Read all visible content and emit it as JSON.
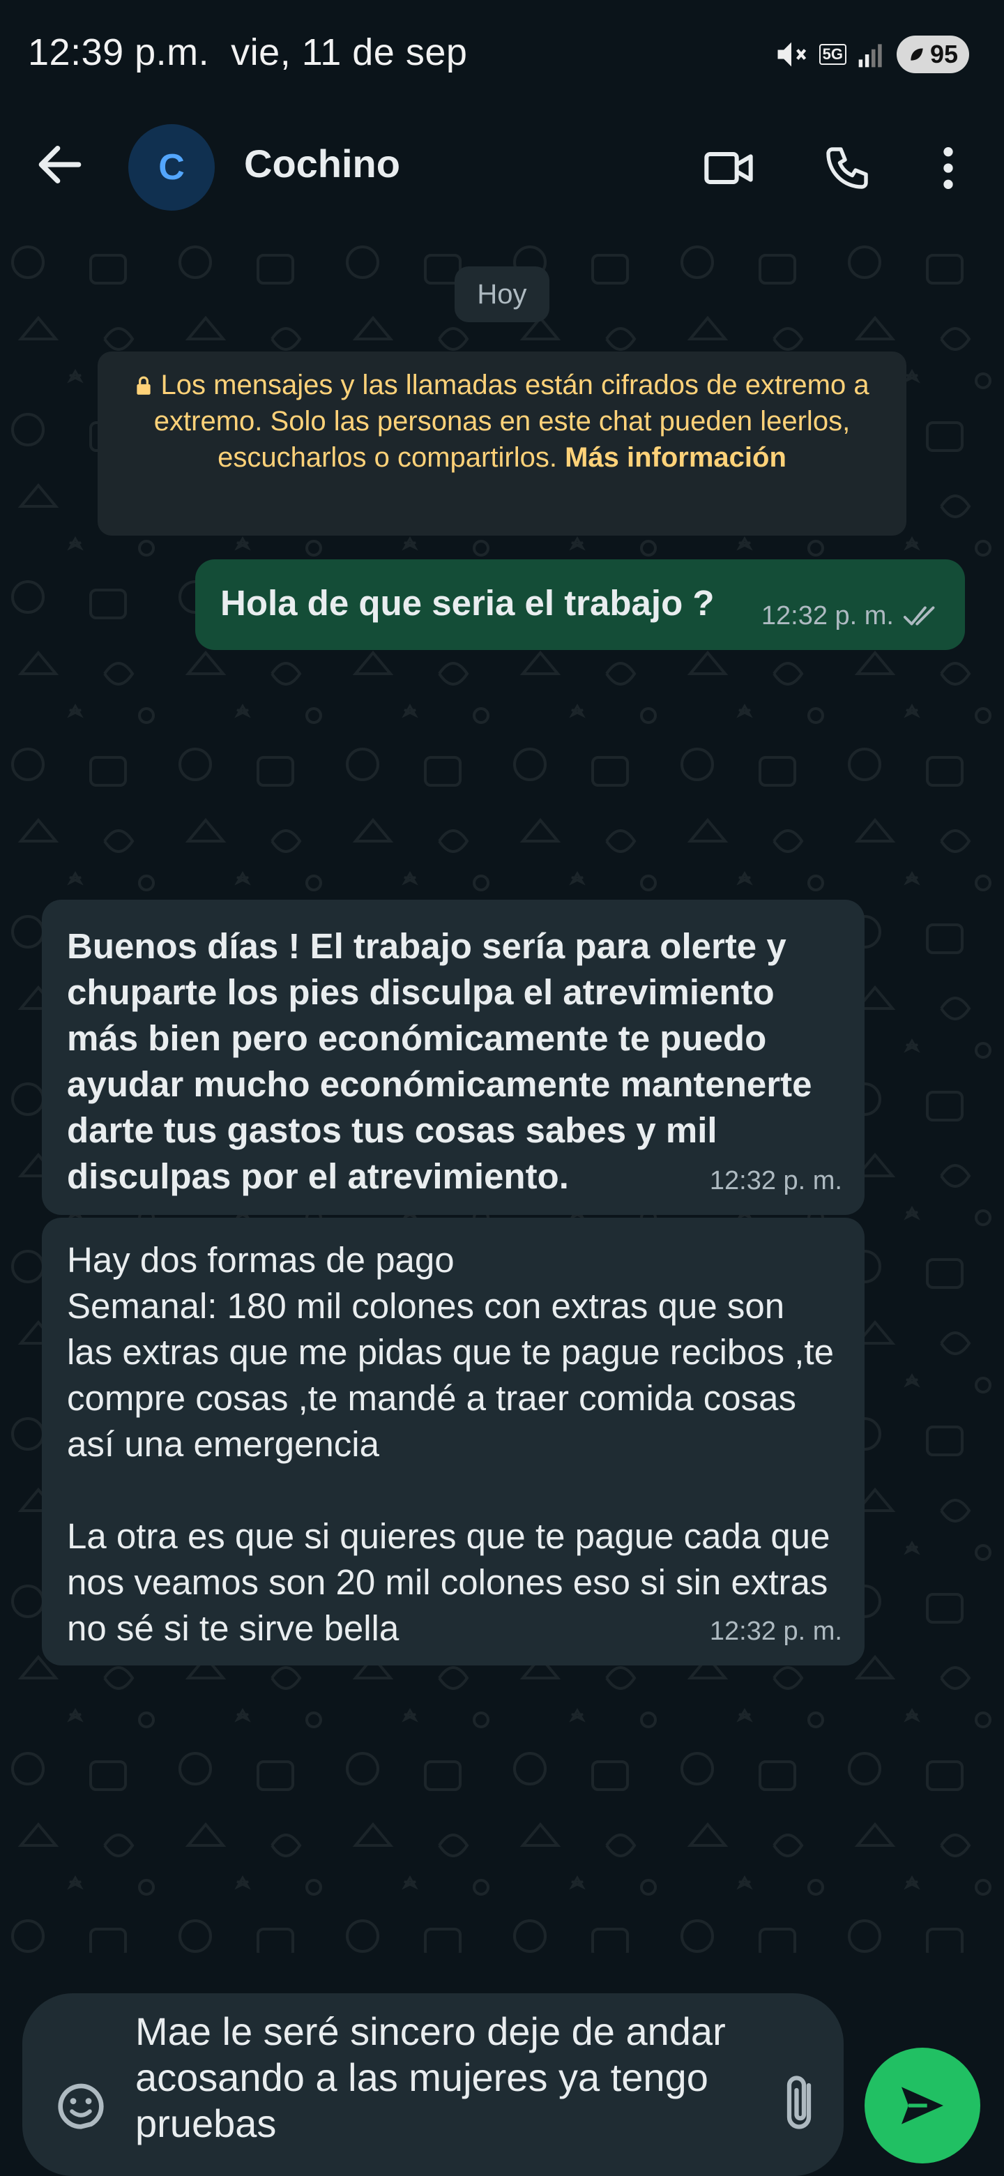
{
  "status_bar": {
    "time": "12:39 p.m.",
    "date": "vie, 11 de sep",
    "network": "5G",
    "battery": "95"
  },
  "header": {
    "avatar_initial": "C",
    "contact_name": "Cochino"
  },
  "chat": {
    "day_label": "Hoy",
    "encryption_notice": "Los mensajes y las llamadas están cifrados de extremo a extremo. Solo las personas en este chat pueden leerlos, escucharlos o compartirlos.",
    "encryption_link": "Más información",
    "messages": [
      {
        "direction": "out",
        "text": "Hola de que seria el trabajo ?",
        "time": "12:32 p. m."
      },
      {
        "direction": "in",
        "text": "Buenos días ! El trabajo sería para olerte y chuparte los pies  disculpa el atrevimiento más bien pero económicamente te puedo ayudar mucho económicamente mantenerte darte tus gastos tus cosas sabes y mil disculpas por el atrevimiento.",
        "time": "12:32 p. m."
      },
      {
        "direction": "in",
        "text": "Hay dos formas de pago\nSemanal: 180 mil colones con extras que son las extras que me pidas que te pague recibos ,te compre cosas ,te mandé a traer comida cosas así una emergencia\n\nLa otra es que si quieres que te pague cada que nos veamos son 20 mil colones eso si sin extras no sé si te sirve bella",
        "time": "12:32 p. m."
      }
    ]
  },
  "composer": {
    "draft": "Mae le seré sincero deje de andar acosando a las mujeres ya tengo pruebas"
  },
  "colors": {
    "outgoing_bubble": "#144d37",
    "incoming_bubble": "#1f2c33",
    "send_button": "#21c063",
    "notice_text": "#ffd279"
  }
}
